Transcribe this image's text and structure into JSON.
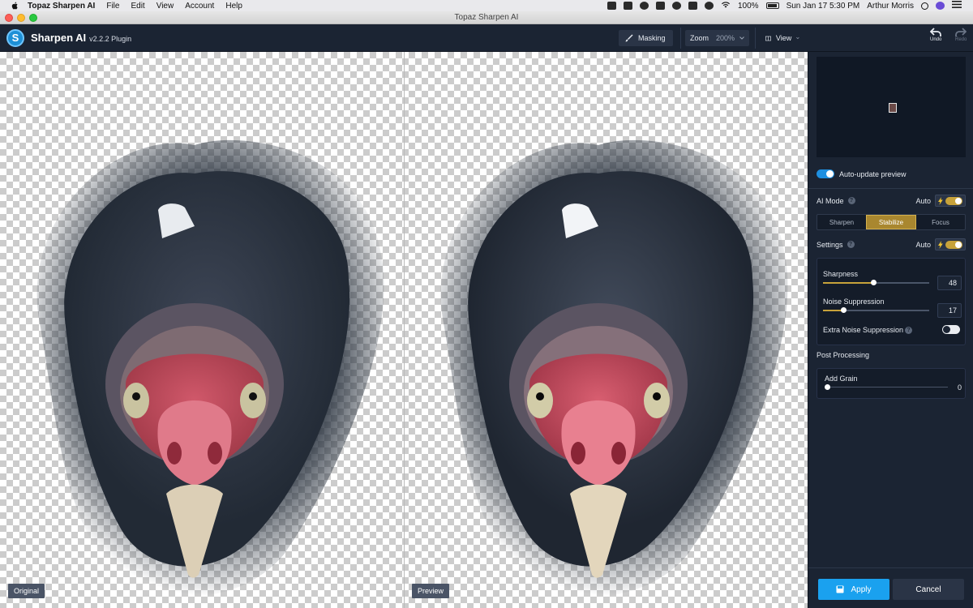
{
  "menubar": {
    "app_name": "Topaz Sharpen AI",
    "items": [
      "File",
      "Edit",
      "View",
      "Account",
      "Help"
    ],
    "battery": "100%",
    "datetime": "Sun Jan 17  5:30 PM",
    "user": "Arthur Morris"
  },
  "window": {
    "title": "Topaz Sharpen AI"
  },
  "header": {
    "app_name": "Sharpen AI",
    "version": "v2.2.2 Plugin",
    "masking_label": "Masking",
    "zoom_label": "Zoom",
    "zoom_value": "200%",
    "view_label": "View",
    "undo_label": "Undo",
    "redo_label": "Redo"
  },
  "canvas": {
    "left_label": "Original",
    "right_label": "Preview"
  },
  "panel": {
    "auto_update_label": "Auto-update preview",
    "auto_update_on": true,
    "ai_mode_label": "AI Mode",
    "auto_label": "Auto",
    "modes": [
      "Sharpen",
      "Stabilize",
      "Focus"
    ],
    "active_mode": "Stabilize",
    "settings_label": "Settings",
    "settings_auto_label": "Auto",
    "sharpness_label": "Sharpness",
    "sharpness_value": "48",
    "noise_label": "Noise Suppression",
    "noise_value": "17",
    "extra_noise_label": "Extra Noise Suppression",
    "post_processing_label": "Post Processing",
    "add_grain_label": "Add Grain",
    "grain_value": "0",
    "apply_label": "Apply",
    "cancel_label": "Cancel"
  },
  "colors": {
    "accent_blue": "#1aa1ef",
    "accent_gold": "#c7a23a",
    "panel_bg": "#1b2433"
  }
}
